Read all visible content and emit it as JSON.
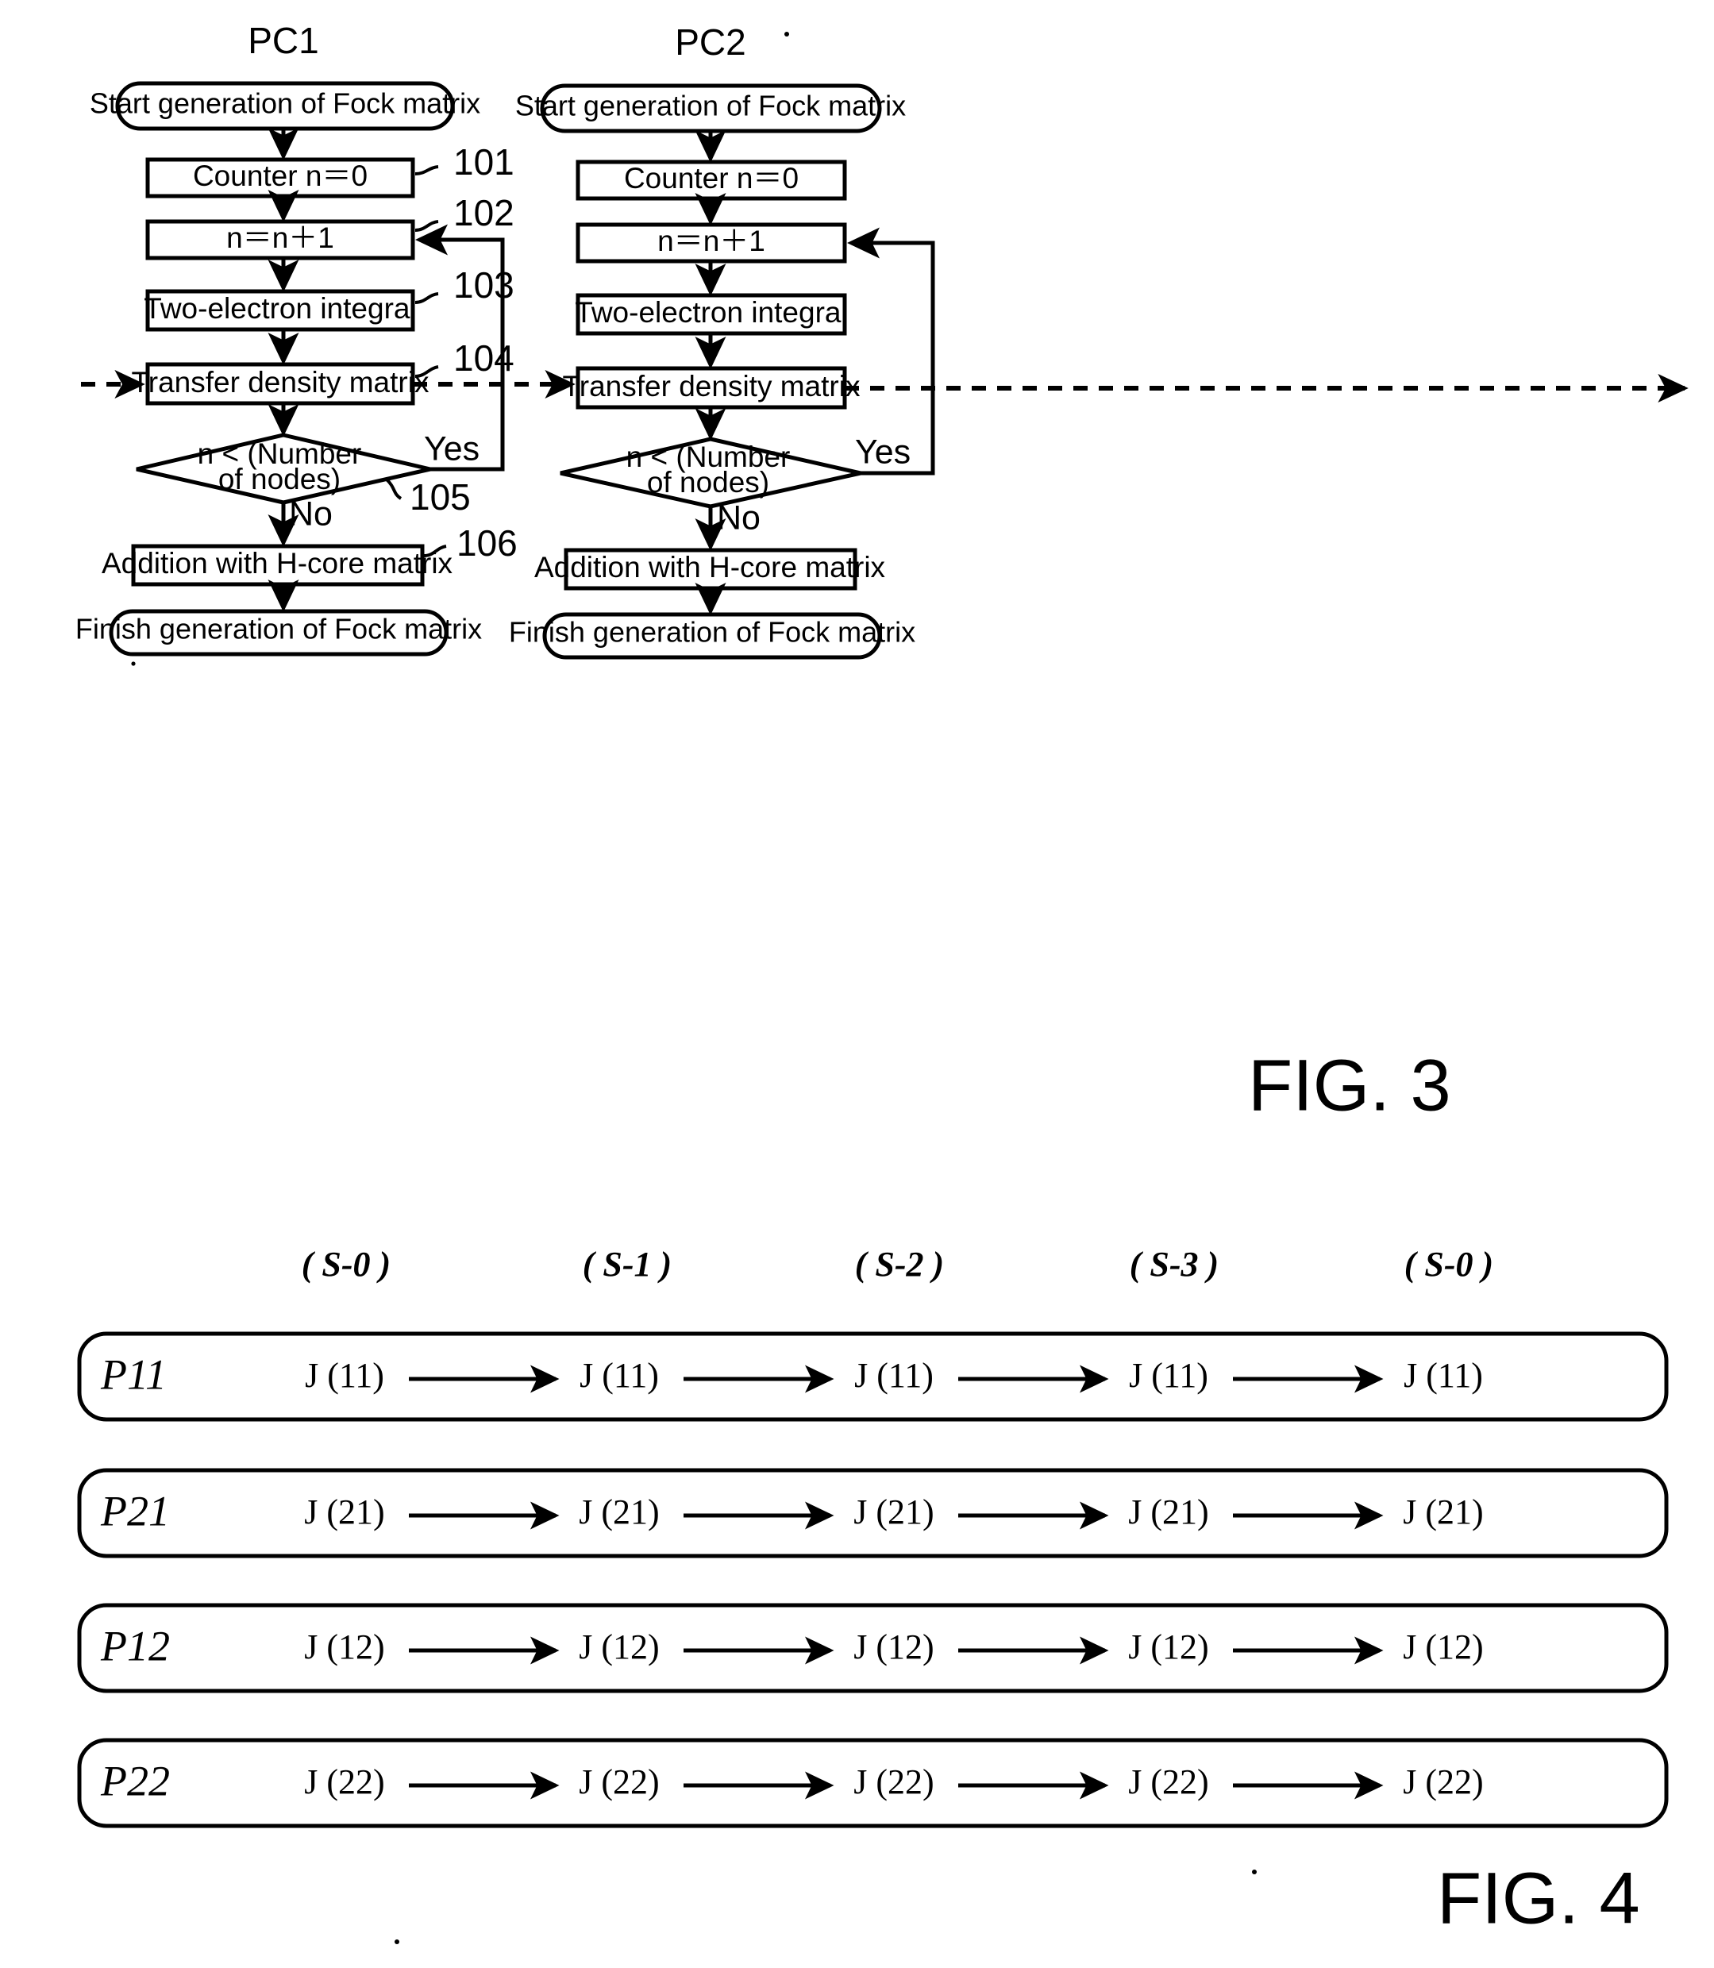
{
  "figure3": {
    "figure_label": "FIG. 3",
    "columns": [
      {
        "header": "PC1",
        "show_reference_numbers": true,
        "start_label": "Start generation of Fock matrix",
        "finish_label": "Finish generation of Fock matrix",
        "steps": [
          {
            "label": "Counter  n＝0",
            "ref": "101"
          },
          {
            "label": "n＝n＋1",
            "ref": "102"
          },
          {
            "label": "Two-electron integral",
            "ref": "103"
          },
          {
            "label": "Transfer density matrix",
            "ref": "104"
          }
        ],
        "decision": {
          "line1": "n < (Number",
          "line2": "of nodes)",
          "yes_label": "Yes",
          "no_label": "No",
          "ref": "105"
        },
        "final_step": {
          "label": "Addition with H-core matrix",
          "ref": "106"
        }
      },
      {
        "header": "PC2",
        "show_reference_numbers": false,
        "start_label": "Start generation of Fock matrix",
        "finish_label": "Finish generation of Fock matrix",
        "steps": [
          {
            "label": "Counter  n＝0",
            "ref": ""
          },
          {
            "label": "n＝n＋1",
            "ref": ""
          },
          {
            "label": "Two-electron integral",
            "ref": ""
          },
          {
            "label": "Transfer density matrix",
            "ref": ""
          }
        ],
        "decision": {
          "line1": "n < (Number",
          "line2": "of nodes)",
          "yes_label": "Yes",
          "no_label": "No",
          "ref": ""
        },
        "final_step": {
          "label": "Addition with H-core matrix",
          "ref": ""
        }
      }
    ]
  },
  "figure4": {
    "figure_label": "FIG. 4",
    "stage_headers": [
      "( S-0 )",
      "( S-1 )",
      "( S-2 )",
      "( S-3 )",
      "( S-0 )"
    ],
    "rows": [
      {
        "row_label": "P11",
        "cells": [
          "J (11)",
          "J (11)",
          "J (11)",
          "J (11)",
          "J (11)"
        ]
      },
      {
        "row_label": "P21",
        "cells": [
          "J (21)",
          "J (21)",
          "J (21)",
          "J (21)",
          "J (21)"
        ]
      },
      {
        "row_label": "P12",
        "cells": [
          "J (12)",
          "J (12)",
          "J (12)",
          "J (12)",
          "J (12)"
        ]
      },
      {
        "row_label": "P22",
        "cells": [
          "J (22)",
          "J (22)",
          "J (22)",
          "J (22)",
          "J (22)"
        ]
      }
    ]
  }
}
